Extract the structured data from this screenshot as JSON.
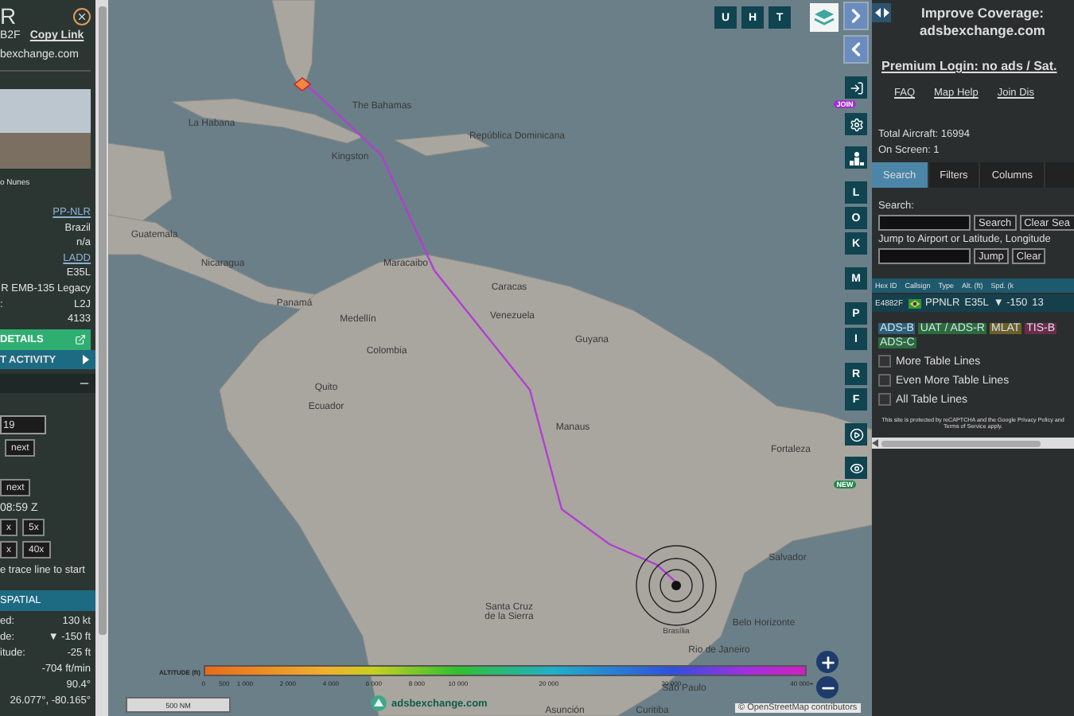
{
  "left_panel": {
    "title": "R",
    "hex": "B2F",
    "copy_link": "Copy Link",
    "site": "bexchange.com",
    "photo_credit": "o Nunes",
    "info_rows": [
      {
        "label": "",
        "value": "PP-NLR",
        "link": true
      },
      {
        "label": "",
        "value": "Brazil",
        "link": false
      },
      {
        "label": "",
        "value": "n/a",
        "link": false
      },
      {
        "label": "",
        "value": "LADD",
        "link": true
      },
      {
        "label": "",
        "value": "E35L",
        "link": false
      },
      {
        "label": "",
        "value": "R EMB-135 Legacy",
        "link": false
      },
      {
        "label": ":",
        "value": "L2J",
        "link": false
      },
      {
        "label": "",
        "value": "4133",
        "link": false
      }
    ],
    "details_button": "DETAILS",
    "activity_header": "T ACTIVITY",
    "date_value": "19",
    "next_buttons": [
      "next",
      "next"
    ],
    "time": "08:59 Z",
    "speed_rows": [
      [
        "x",
        "5x"
      ],
      [
        "x",
        "40x"
      ]
    ],
    "trace_hint": "e trace line to start",
    "spatial_header": "SPATIAL",
    "spatial_rows": [
      {
        "label": "ed:",
        "value": "130 kt"
      },
      {
        "label": "de:",
        "value": "▼ -150 ft"
      },
      {
        "label": "itude:",
        "value": "-25 ft"
      },
      {
        "label": "",
        "value": "-704 ft/min"
      },
      {
        "label": "",
        "value": "90.4°"
      },
      {
        "label": "",
        "value": "26.077°, -80.165°"
      }
    ]
  },
  "map": {
    "top_buttons": [
      "U",
      "H",
      "T"
    ],
    "letter_groups": [
      [
        "L",
        "O",
        "K"
      ],
      [
        "M"
      ],
      [
        "P",
        "I"
      ],
      [
        "R",
        "F"
      ]
    ],
    "join_badge": "JOIN",
    "new_badge": "NEW",
    "labels": [
      "The Bahamas",
      "La Habana",
      "Kingston",
      "República Dominicana",
      "Guatemala",
      "Nicaragua",
      "Panamá",
      "Maracaibo",
      "Caracas",
      "Medellín",
      "Venezuela",
      "Colombia",
      "Guyana",
      "Quito",
      "Ecuador",
      "Manaus",
      "Fortaleza",
      "Salvador",
      "Brasília",
      "Santa Cruz de la Sierra",
      "Belo Horizonte",
      "Rio de Janeiro",
      "São Paulo",
      "Asunción",
      "Curitiba"
    ],
    "legend": {
      "title": "ALTITUDE (ft)",
      "ticks": [
        "0",
        "500",
        "1 000",
        "2 000",
        "4 000",
        "6 000",
        "8 000",
        "10 000",
        "20 000",
        "30 000",
        "40 000+"
      ]
    },
    "scale": "500 NM",
    "logo": "adsbexchange.com",
    "attribution": "© OpenStreetMap contributors"
  },
  "right_panel": {
    "improve": "Improve Coverage:",
    "improve_link": "adsbexchange.com",
    "premium": "Premium Login: no ads / Sat.",
    "links": [
      "FAQ",
      "Map Help",
      "Join Dis"
    ],
    "total": "Total Aircraft: 16994",
    "on_screen": "On Screen: 1",
    "tabs": [
      {
        "label": "Search",
        "selected": true
      },
      {
        "label": "Filters",
        "selected": false
      },
      {
        "label": "Columns",
        "selected": false
      }
    ],
    "search_label": "Search:",
    "search_buttons": [
      "Search",
      "Clear Sea"
    ],
    "jump_label": "Jump to Airport or Latitude, Longitude",
    "jump_buttons": [
      "Jump",
      "Clear"
    ],
    "table": {
      "columns": [
        "Hex ID",
        "Callsign",
        "Type",
        "Alt. (ft)",
        "Spd. (k"
      ],
      "rows": [
        {
          "hex": "E4882F",
          "callsign": "PPNLR",
          "type": "E35L",
          "alt": "▼ -150",
          "speed": "13"
        }
      ]
    },
    "sources": [
      {
        "label": "ADS-B",
        "color": "#2e5f7a"
      },
      {
        "label": "UAT / ADS-R",
        "color": "#2d6a3c"
      },
      {
        "label": "MLAT",
        "color": "#6e5f2a"
      },
      {
        "label": "TIS-B",
        "color": "#6e2a48"
      },
      {
        "label": "ADS-C",
        "color": "#2d6a3c"
      }
    ],
    "options": [
      {
        "label": "More Table Lines",
        "checked": false
      },
      {
        "label": "Even More Table Lines",
        "checked": false
      },
      {
        "label": "All Table Lines",
        "checked": false
      }
    ],
    "notice": "This site is protected by reCAPTCHA and the Google Privacy Policy and Terms of Service apply."
  }
}
